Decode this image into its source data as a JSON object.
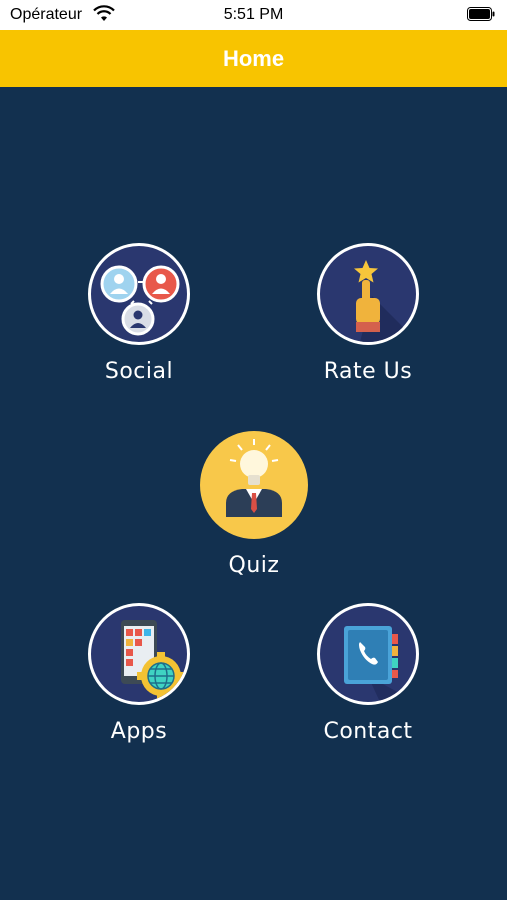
{
  "status_bar": {
    "carrier": "Opérateur",
    "time": "5:51 PM"
  },
  "header": {
    "title": "Home"
  },
  "menu": {
    "social": {
      "label": "Social",
      "icon": "people-network-icon"
    },
    "rate_us": {
      "label": "Rate Us",
      "icon": "star-hand-icon"
    },
    "quiz": {
      "label": "Quiz",
      "icon": "lightbulb-person-icon"
    },
    "apps": {
      "label": "Apps",
      "icon": "phone-apps-gear-icon"
    },
    "contact": {
      "label": "Contact",
      "icon": "phonebook-icon"
    }
  },
  "colors": {
    "background": "#12304f",
    "header": "#f8c400",
    "icon_circle": "#2a376f",
    "quiz_circle": "#f8c84a"
  }
}
